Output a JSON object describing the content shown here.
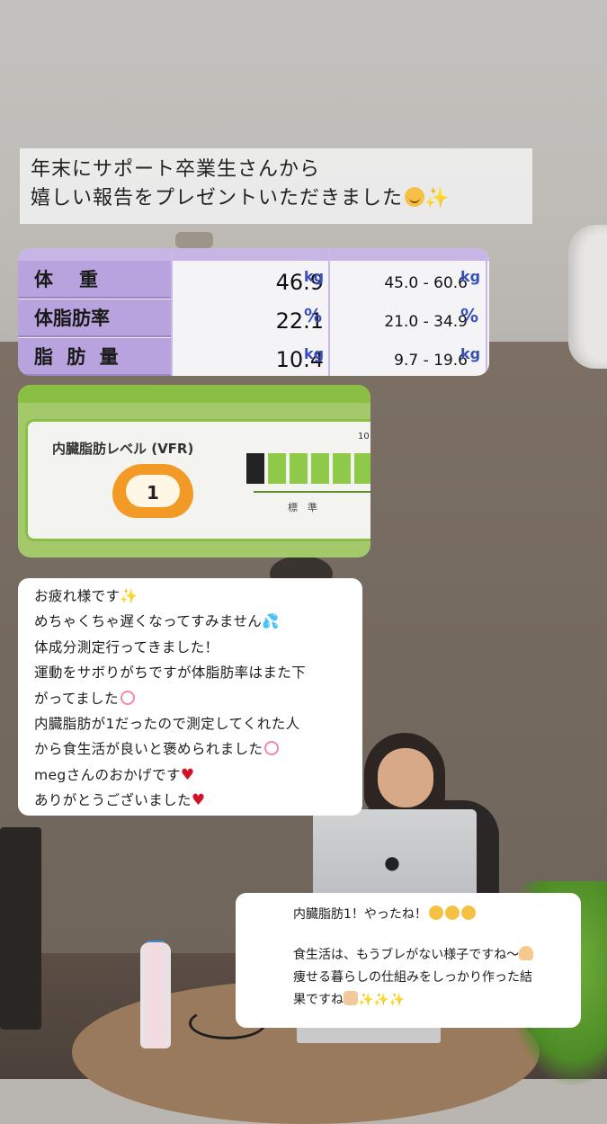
{
  "caption": {
    "line1": "年末にサポート卒業生さんから",
    "line2": "嬉しい報告をプレゼントいただきました"
  },
  "measurements": {
    "rows": [
      {
        "label": "体　重",
        "value": "46.9",
        "unit": "kg",
        "range": "45.0 - 60.6",
        "range_unit": "kg"
      },
      {
        "label": "体脂肪率",
        "value": "22.1",
        "unit": "%",
        "range": "21.0 - 34.9",
        "range_unit": "%"
      },
      {
        "label": "脂 肪 量",
        "value": "10.4",
        "unit": "kg",
        "range": "9.7 - 19.6",
        "range_unit": "kg"
      }
    ]
  },
  "vfr": {
    "title": "内臓脂肪レベル (VFR)",
    "level": "1",
    "scale_label": "標　準",
    "edge_label": "10"
  },
  "message_student": {
    "lines": [
      "お疲れ様です",
      "めちゃくちゃ遅くなってすみません",
      "体成分測定行ってきました！",
      "運動をサボりがちですが体脂肪率はまた下",
      "がってました",
      "内臓脂肪が1だったので測定してくれた人",
      "から食生活が良いと褒められました",
      "megさんのおかげです",
      "ありがとうございました"
    ]
  },
  "message_reply": {
    "line1": "内臓脂肪1！やったね！",
    "line2": "食生活は、もうブレがない様子ですね〜",
    "line3": "痩せる暮らしの仕組みをしっかり作った結",
    "line4": "果ですね"
  },
  "colors": {
    "measure_label_bg": "#b9a3de",
    "unit_blue": "#3a4fb8",
    "vfr_green": "#8bbe45",
    "vfr_badge_orange": "#f39a26",
    "heart_red": "#d1132a"
  }
}
